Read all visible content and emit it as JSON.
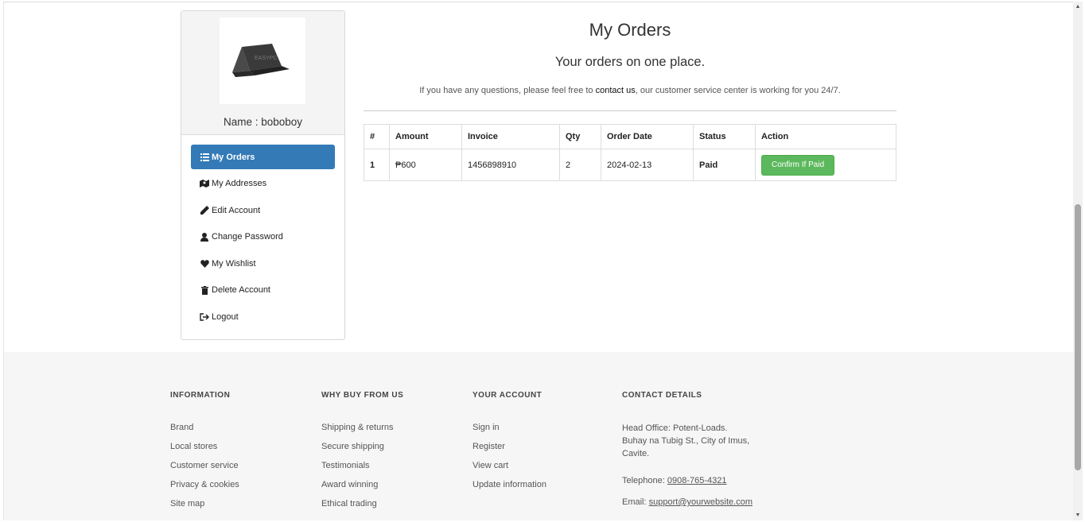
{
  "profile": {
    "name_text": "Name : boboboy",
    "avatar_watermark": "EASYPC"
  },
  "sidebar": {
    "items": [
      {
        "label": "My Orders",
        "icon": "list-icon",
        "active": true
      },
      {
        "label": "My Addresses",
        "icon": "map-icon",
        "active": false
      },
      {
        "label": "Edit Account",
        "icon": "pencil-icon",
        "active": false
      },
      {
        "label": "Change Password",
        "icon": "user-icon",
        "active": false
      },
      {
        "label": "My Wishlist",
        "icon": "heart-icon",
        "active": false
      },
      {
        "label": "Delete Account",
        "icon": "trash-icon",
        "active": false
      },
      {
        "label": "Logout",
        "icon": "logout-icon",
        "active": false
      }
    ]
  },
  "main": {
    "title": "My Orders",
    "subtitle": "Your orders on one place.",
    "info_before": "If you have any questions, please feel free to ",
    "info_link": "contact us",
    "info_after": ", our customer service center is working for you 24/7."
  },
  "orders": {
    "columns": [
      "#",
      "Amount",
      "Invoice",
      "Qty",
      "Order Date",
      "Status",
      "Action"
    ],
    "rows": [
      {
        "num": "1",
        "amount": "₱600",
        "invoice": "1456898910",
        "qty": "2",
        "date": "2024-02-13",
        "status": "Paid",
        "action_label": "Confirm If Paid"
      }
    ]
  },
  "footer": {
    "information": {
      "heading": "INFORMATION",
      "links": [
        "Brand",
        "Local stores",
        "Customer service",
        "Privacy & cookies",
        "Site map"
      ]
    },
    "why": {
      "heading": "WHY BUY FROM US",
      "links": [
        "Shipping & returns",
        "Secure shipping",
        "Testimonials",
        "Award winning",
        "Ethical trading"
      ]
    },
    "account": {
      "heading": "YOUR ACCOUNT",
      "links": [
        "Sign in",
        "Register",
        "View cart",
        "Update information"
      ]
    },
    "contact": {
      "heading": "CONTACT DETAILS",
      "address_1": "Head Office: Potent-Loads.",
      "address_2": "Buhay na Tubig St., City of Imus,",
      "address_3": "Cavite.",
      "tel_label": "Telephone: ",
      "tel": "0908-765-4321",
      "email_label": "Email: ",
      "email": "support@yourwebsite.com"
    }
  },
  "colors": {
    "primary": "#337ab7",
    "success": "#5cb85c",
    "paid": "#1d7a1d",
    "footer_bg": "#f6f6f6"
  }
}
